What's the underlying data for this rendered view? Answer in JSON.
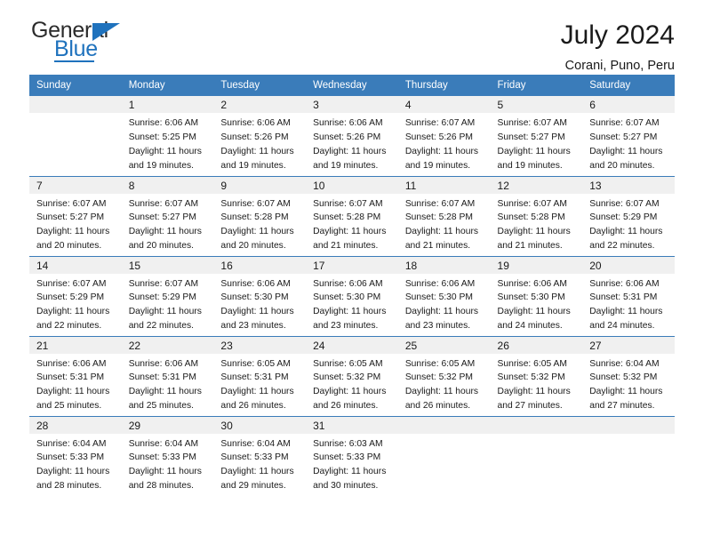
{
  "brand": {
    "name_top": "General",
    "name_bottom": "Blue"
  },
  "header": {
    "title": "July 2024",
    "subtitle": "Corani, Puno, Peru"
  },
  "colors": {
    "header_blue": "#3a7cba",
    "brand_blue": "#1f72bd",
    "daynum_band": "#f0f0f0",
    "text": "#1a1a1a"
  },
  "weekdays": [
    "Sunday",
    "Monday",
    "Tuesday",
    "Wednesday",
    "Thursday",
    "Friday",
    "Saturday"
  ],
  "labels": {
    "sunrise_prefix": "Sunrise:",
    "sunset_prefix": "Sunset:",
    "daylight_prefix": "Daylight:"
  },
  "weeks": [
    [
      {
        "day": ""
      },
      {
        "day": "1",
        "sunrise": "Sunrise: 6:06 AM",
        "sunset": "Sunset: 5:25 PM",
        "daylight_1": "Daylight: 11 hours",
        "daylight_2": "and 19 minutes."
      },
      {
        "day": "2",
        "sunrise": "Sunrise: 6:06 AM",
        "sunset": "Sunset: 5:26 PM",
        "daylight_1": "Daylight: 11 hours",
        "daylight_2": "and 19 minutes."
      },
      {
        "day": "3",
        "sunrise": "Sunrise: 6:06 AM",
        "sunset": "Sunset: 5:26 PM",
        "daylight_1": "Daylight: 11 hours",
        "daylight_2": "and 19 minutes."
      },
      {
        "day": "4",
        "sunrise": "Sunrise: 6:07 AM",
        "sunset": "Sunset: 5:26 PM",
        "daylight_1": "Daylight: 11 hours",
        "daylight_2": "and 19 minutes."
      },
      {
        "day": "5",
        "sunrise": "Sunrise: 6:07 AM",
        "sunset": "Sunset: 5:27 PM",
        "daylight_1": "Daylight: 11 hours",
        "daylight_2": "and 19 minutes."
      },
      {
        "day": "6",
        "sunrise": "Sunrise: 6:07 AM",
        "sunset": "Sunset: 5:27 PM",
        "daylight_1": "Daylight: 11 hours",
        "daylight_2": "and 20 minutes."
      }
    ],
    [
      {
        "day": "7",
        "sunrise": "Sunrise: 6:07 AM",
        "sunset": "Sunset: 5:27 PM",
        "daylight_1": "Daylight: 11 hours",
        "daylight_2": "and 20 minutes."
      },
      {
        "day": "8",
        "sunrise": "Sunrise: 6:07 AM",
        "sunset": "Sunset: 5:27 PM",
        "daylight_1": "Daylight: 11 hours",
        "daylight_2": "and 20 minutes."
      },
      {
        "day": "9",
        "sunrise": "Sunrise: 6:07 AM",
        "sunset": "Sunset: 5:28 PM",
        "daylight_1": "Daylight: 11 hours",
        "daylight_2": "and 20 minutes."
      },
      {
        "day": "10",
        "sunrise": "Sunrise: 6:07 AM",
        "sunset": "Sunset: 5:28 PM",
        "daylight_1": "Daylight: 11 hours",
        "daylight_2": "and 21 minutes."
      },
      {
        "day": "11",
        "sunrise": "Sunrise: 6:07 AM",
        "sunset": "Sunset: 5:28 PM",
        "daylight_1": "Daylight: 11 hours",
        "daylight_2": "and 21 minutes."
      },
      {
        "day": "12",
        "sunrise": "Sunrise: 6:07 AM",
        "sunset": "Sunset: 5:28 PM",
        "daylight_1": "Daylight: 11 hours",
        "daylight_2": "and 21 minutes."
      },
      {
        "day": "13",
        "sunrise": "Sunrise: 6:07 AM",
        "sunset": "Sunset: 5:29 PM",
        "daylight_1": "Daylight: 11 hours",
        "daylight_2": "and 22 minutes."
      }
    ],
    [
      {
        "day": "14",
        "sunrise": "Sunrise: 6:07 AM",
        "sunset": "Sunset: 5:29 PM",
        "daylight_1": "Daylight: 11 hours",
        "daylight_2": "and 22 minutes."
      },
      {
        "day": "15",
        "sunrise": "Sunrise: 6:07 AM",
        "sunset": "Sunset: 5:29 PM",
        "daylight_1": "Daylight: 11 hours",
        "daylight_2": "and 22 minutes."
      },
      {
        "day": "16",
        "sunrise": "Sunrise: 6:06 AM",
        "sunset": "Sunset: 5:30 PM",
        "daylight_1": "Daylight: 11 hours",
        "daylight_2": "and 23 minutes."
      },
      {
        "day": "17",
        "sunrise": "Sunrise: 6:06 AM",
        "sunset": "Sunset: 5:30 PM",
        "daylight_1": "Daylight: 11 hours",
        "daylight_2": "and 23 minutes."
      },
      {
        "day": "18",
        "sunrise": "Sunrise: 6:06 AM",
        "sunset": "Sunset: 5:30 PM",
        "daylight_1": "Daylight: 11 hours",
        "daylight_2": "and 23 minutes."
      },
      {
        "day": "19",
        "sunrise": "Sunrise: 6:06 AM",
        "sunset": "Sunset: 5:30 PM",
        "daylight_1": "Daylight: 11 hours",
        "daylight_2": "and 24 minutes."
      },
      {
        "day": "20",
        "sunrise": "Sunrise: 6:06 AM",
        "sunset": "Sunset: 5:31 PM",
        "daylight_1": "Daylight: 11 hours",
        "daylight_2": "and 24 minutes."
      }
    ],
    [
      {
        "day": "21",
        "sunrise": "Sunrise: 6:06 AM",
        "sunset": "Sunset: 5:31 PM",
        "daylight_1": "Daylight: 11 hours",
        "daylight_2": "and 25 minutes."
      },
      {
        "day": "22",
        "sunrise": "Sunrise: 6:06 AM",
        "sunset": "Sunset: 5:31 PM",
        "daylight_1": "Daylight: 11 hours",
        "daylight_2": "and 25 minutes."
      },
      {
        "day": "23",
        "sunrise": "Sunrise: 6:05 AM",
        "sunset": "Sunset: 5:31 PM",
        "daylight_1": "Daylight: 11 hours",
        "daylight_2": "and 26 minutes."
      },
      {
        "day": "24",
        "sunrise": "Sunrise: 6:05 AM",
        "sunset": "Sunset: 5:32 PM",
        "daylight_1": "Daylight: 11 hours",
        "daylight_2": "and 26 minutes."
      },
      {
        "day": "25",
        "sunrise": "Sunrise: 6:05 AM",
        "sunset": "Sunset: 5:32 PM",
        "daylight_1": "Daylight: 11 hours",
        "daylight_2": "and 26 minutes."
      },
      {
        "day": "26",
        "sunrise": "Sunrise: 6:05 AM",
        "sunset": "Sunset: 5:32 PM",
        "daylight_1": "Daylight: 11 hours",
        "daylight_2": "and 27 minutes."
      },
      {
        "day": "27",
        "sunrise": "Sunrise: 6:04 AM",
        "sunset": "Sunset: 5:32 PM",
        "daylight_1": "Daylight: 11 hours",
        "daylight_2": "and 27 minutes."
      }
    ],
    [
      {
        "day": "28",
        "sunrise": "Sunrise: 6:04 AM",
        "sunset": "Sunset: 5:33 PM",
        "daylight_1": "Daylight: 11 hours",
        "daylight_2": "and 28 minutes."
      },
      {
        "day": "29",
        "sunrise": "Sunrise: 6:04 AM",
        "sunset": "Sunset: 5:33 PM",
        "daylight_1": "Daylight: 11 hours",
        "daylight_2": "and 28 minutes."
      },
      {
        "day": "30",
        "sunrise": "Sunrise: 6:04 AM",
        "sunset": "Sunset: 5:33 PM",
        "daylight_1": "Daylight: 11 hours",
        "daylight_2": "and 29 minutes."
      },
      {
        "day": "31",
        "sunrise": "Sunrise: 6:03 AM",
        "sunset": "Sunset: 5:33 PM",
        "daylight_1": "Daylight: 11 hours",
        "daylight_2": "and 30 minutes."
      },
      {
        "day": ""
      },
      {
        "day": ""
      },
      {
        "day": ""
      }
    ]
  ]
}
